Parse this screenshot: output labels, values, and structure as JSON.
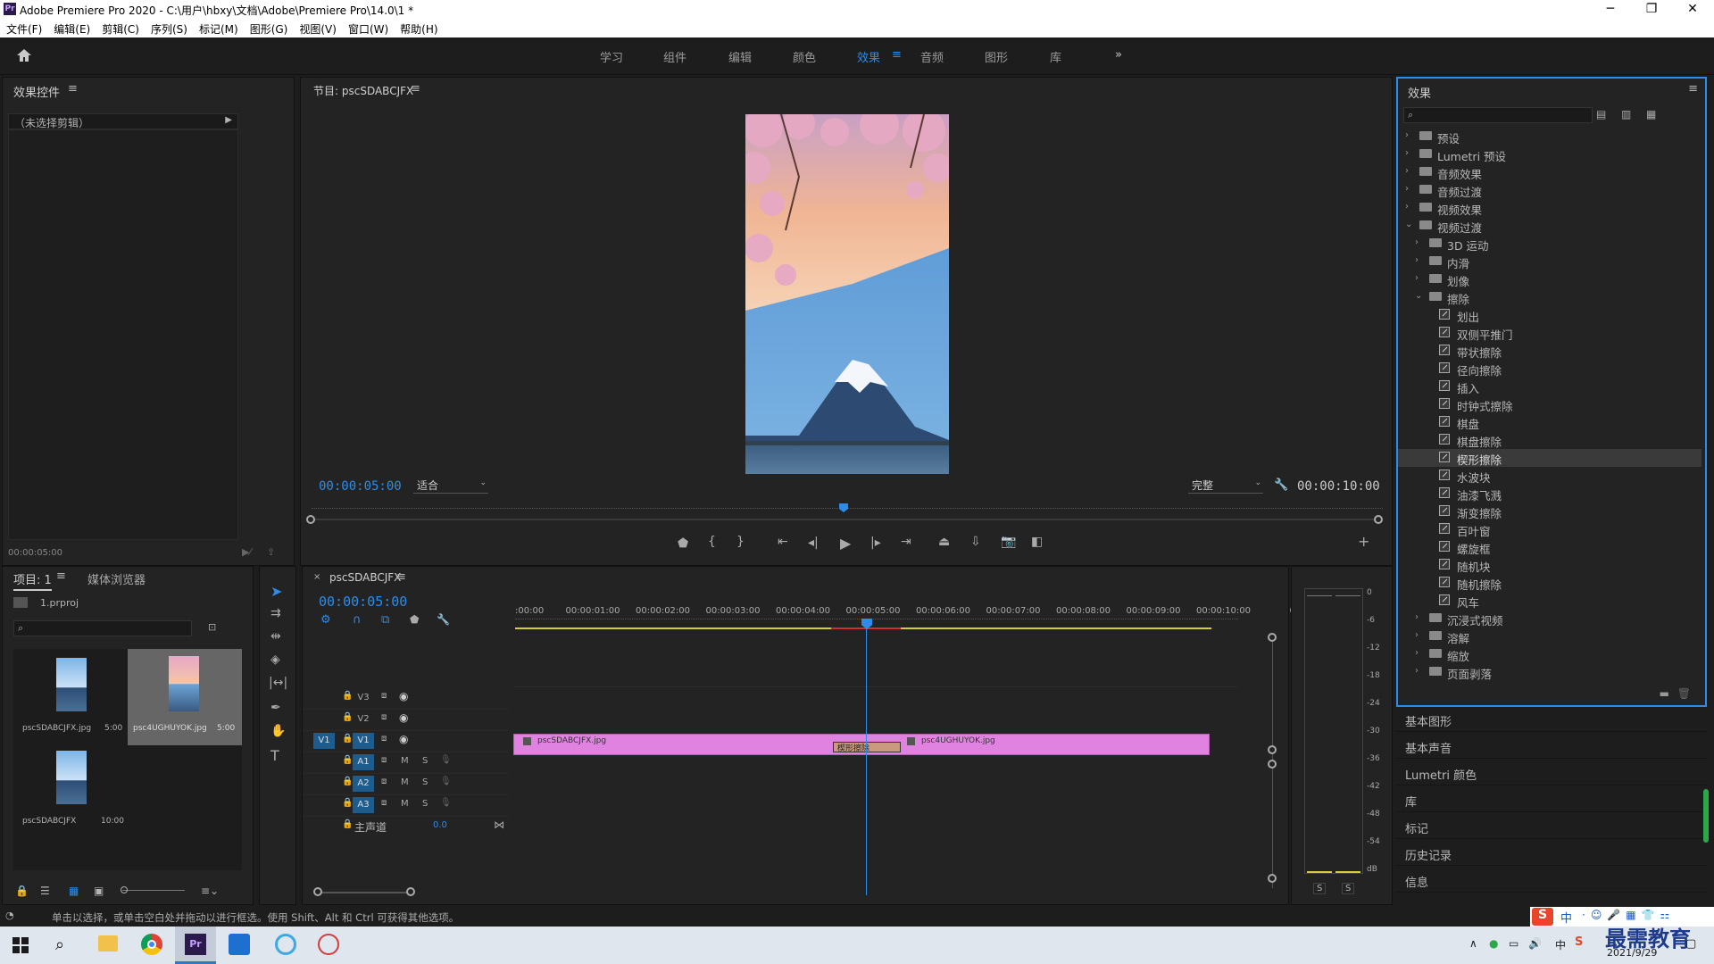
{
  "window": {
    "title": "Adobe Premiere Pro 2020 - C:\\用户\\hbxy\\文档\\Adobe\\Premiere Pro\\14.0\\1 *"
  },
  "menu": [
    "文件(F)",
    "编辑(E)",
    "剪辑(C)",
    "序列(S)",
    "标记(M)",
    "图形(G)",
    "视图(V)",
    "窗口(W)",
    "帮助(H)"
  ],
  "workspaces": [
    "学习",
    "组件",
    "编辑",
    "颜色",
    "效果",
    "音频",
    "图形",
    "库"
  ],
  "active_workspace": "效果",
  "effect_controls": {
    "title": "效果控件",
    "no_clip": "（未选择剪辑）",
    "timecode": "00:00:05:00"
  },
  "program": {
    "title": "节目: pscSDABCJFX",
    "timecode": "00:00:05:00",
    "fit": "适合",
    "quality": "完整",
    "duration": "00:00:10:00"
  },
  "project": {
    "tab1": "项目: 1",
    "tab2": "媒体浏览器",
    "file": "1.prproj",
    "items": [
      {
        "name": "pscSDABCJFX.jpg",
        "dur": "5:00"
      },
      {
        "name": "psc4UGHUYOK.jpg",
        "dur": "5:00"
      },
      {
        "name": "pscSDABCJFX",
        "dur": "10:00"
      }
    ]
  },
  "timeline": {
    "tab": "pscSDABCJFX",
    "timecode": "00:00:05:00",
    "ruler": [
      ":00:00",
      "00:00:01:00",
      "00:00:02:00",
      "00:00:03:00",
      "00:00:04:00",
      "00:00:05:00",
      "00:00:06:00",
      "00:00:07:00",
      "00:00:08:00",
      "00:00:09:00",
      "00:00:10:00",
      "0"
    ],
    "tracks": [
      "V3",
      "V2",
      "V1",
      "A1",
      "A2",
      "A3"
    ],
    "source_patch": "V1",
    "master": "主声道",
    "master_val": "0.0",
    "clip1": "pscSDABCJFX.jpg",
    "clip2": "psc4UGHUYOK.jpg",
    "transition": "楔形擦除",
    "m": "M",
    "s": "S"
  },
  "meter": {
    "scale": [
      "0",
      "-6",
      "-12",
      "-18",
      "-24",
      "-30",
      "-36",
      "-42",
      "-48",
      "-54",
      "dB"
    ],
    "s1": "S",
    "s2": "S"
  },
  "effects": {
    "title": "效果",
    "tree": [
      {
        "label": "预设",
        "level": 0,
        "type": "folder",
        "open": false
      },
      {
        "label": "Lumetri 预设",
        "level": 0,
        "type": "folder",
        "open": false
      },
      {
        "label": "音频效果",
        "level": 0,
        "type": "folder",
        "open": false
      },
      {
        "label": "音频过渡",
        "level": 0,
        "type": "folder",
        "open": false
      },
      {
        "label": "视频效果",
        "level": 0,
        "type": "folder",
        "open": false
      },
      {
        "label": "视频过渡",
        "level": 0,
        "type": "folder",
        "open": true
      },
      {
        "label": "3D 运动",
        "level": 1,
        "type": "folder",
        "open": false
      },
      {
        "label": "内滑",
        "level": 1,
        "type": "folder",
        "open": false
      },
      {
        "label": "划像",
        "level": 1,
        "type": "folder",
        "open": false
      },
      {
        "label": "擦除",
        "level": 1,
        "type": "folder",
        "open": true
      },
      {
        "label": "划出",
        "level": 2,
        "type": "fx"
      },
      {
        "label": "双侧平推门",
        "level": 2,
        "type": "fx"
      },
      {
        "label": "带状擦除",
        "level": 2,
        "type": "fx"
      },
      {
        "label": "径向擦除",
        "level": 2,
        "type": "fx"
      },
      {
        "label": "插入",
        "level": 2,
        "type": "fx"
      },
      {
        "label": "时钟式擦除",
        "level": 2,
        "type": "fx"
      },
      {
        "label": "棋盘",
        "level": 2,
        "type": "fx"
      },
      {
        "label": "棋盘擦除",
        "level": 2,
        "type": "fx"
      },
      {
        "label": "楔形擦除",
        "level": 2,
        "type": "fx",
        "selected": true
      },
      {
        "label": "水波块",
        "level": 2,
        "type": "fx"
      },
      {
        "label": "油漆飞溅",
        "level": 2,
        "type": "fx"
      },
      {
        "label": "渐变擦除",
        "level": 2,
        "type": "fx"
      },
      {
        "label": "百叶窗",
        "level": 2,
        "type": "fx"
      },
      {
        "label": "螺旋框",
        "level": 2,
        "type": "fx"
      },
      {
        "label": "随机块",
        "level": 2,
        "type": "fx"
      },
      {
        "label": "随机擦除",
        "level": 2,
        "type": "fx"
      },
      {
        "label": "风车",
        "level": 2,
        "type": "fx"
      },
      {
        "label": "沉浸式视频",
        "level": 1,
        "type": "folder",
        "open": false
      },
      {
        "label": "溶解",
        "level": 1,
        "type": "folder",
        "open": false
      },
      {
        "label": "缩放",
        "level": 1,
        "type": "folder",
        "open": false
      },
      {
        "label": "页面剥落",
        "level": 1,
        "type": "folder",
        "open": false
      }
    ],
    "collapsed_panels": [
      "基本图形",
      "基本声音",
      "Lumetri 颜色",
      "库",
      "标记",
      "历史记录",
      "信息"
    ]
  },
  "status": "单击以选择，或单击空白处并拖动以进行框选。使用 Shift、Alt 和 Ctrl 可获得其他选项。",
  "taskbar": {
    "date": "2021/9/29",
    "ime": "中",
    "watermark": "最需教育"
  },
  "colors": {
    "accent": "#2d8ceb",
    "clip": "#e083e0",
    "workarea": "#d4cf3a",
    "transition": "#c99a7e"
  }
}
